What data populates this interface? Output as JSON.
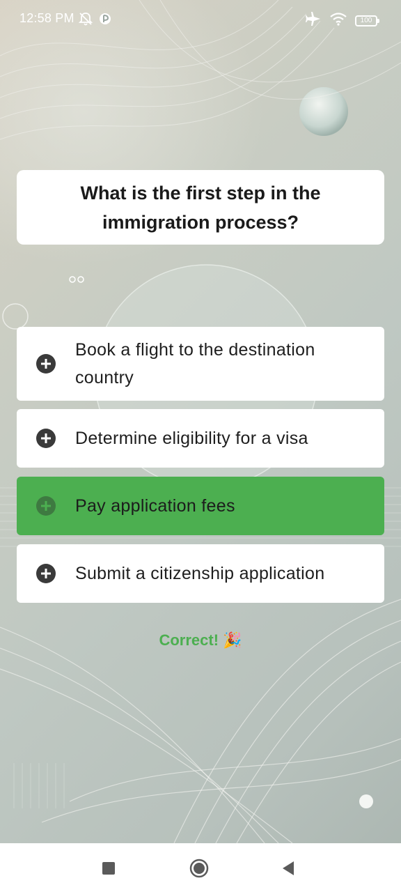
{
  "status_bar": {
    "time": "12:58 PM",
    "battery": "100",
    "icons": [
      "mute-alarm-icon",
      "app-notification-icon",
      "airplane-icon",
      "wifi-icon",
      "battery-icon"
    ]
  },
  "quiz": {
    "question": "What is the first step in the immigration process?",
    "options": [
      {
        "label": "Book a flight to the destination country",
        "icon": "plus-circle-icon"
      },
      {
        "label": "Determine eligibility for a visa",
        "icon": "plus-circle-icon"
      },
      {
        "label": "Pay application fees",
        "icon": "plus-circle-icon",
        "highlighted": true
      },
      {
        "label": "Submit a citizenship application",
        "icon": "plus-circle-icon"
      }
    ],
    "feedback": "Correct! 🎉"
  },
  "nav_bar": {
    "buttons": [
      "recents-square-icon",
      "home-circle-icon",
      "back-triangle-icon"
    ]
  },
  "colors": {
    "correct_green": "#4caf50",
    "card_white": "#ffffff",
    "text_dark": "#1a1a1a"
  }
}
